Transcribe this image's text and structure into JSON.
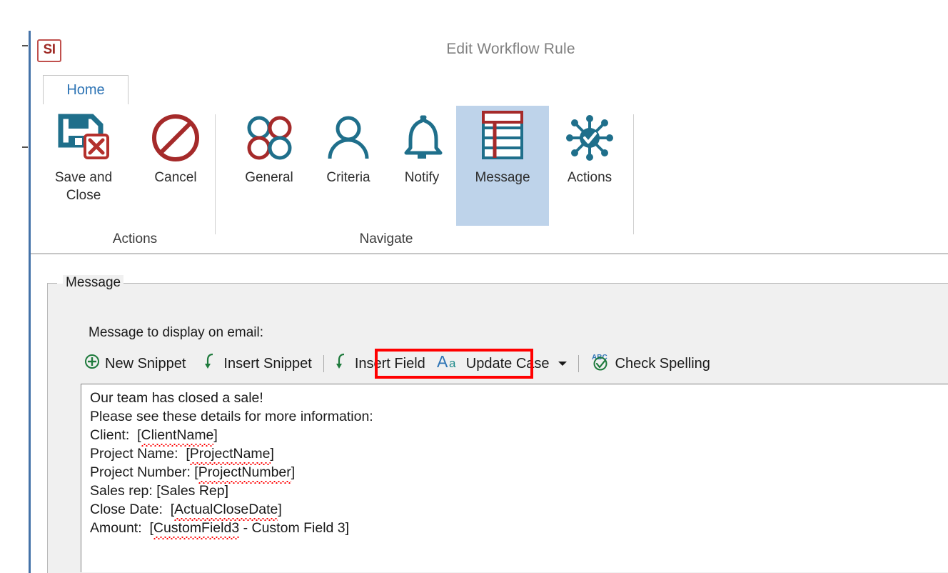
{
  "window": {
    "logo_text": "SI",
    "title": "Edit Workflow Rule"
  },
  "tabs": [
    {
      "label": "Home",
      "selected": true
    }
  ],
  "ribbon": {
    "groups": [
      {
        "name": "actions",
        "label": "Actions",
        "buttons": [
          {
            "name": "save-and-close",
            "label": "Save and\nClose",
            "icon": "save-close-icon"
          },
          {
            "name": "cancel",
            "label": "Cancel",
            "icon": "cancel-icon"
          }
        ]
      },
      {
        "name": "navigate",
        "label": "Navigate",
        "buttons": [
          {
            "name": "general",
            "label": "General",
            "icon": "four-circles-icon",
            "selected": false
          },
          {
            "name": "criteria",
            "label": "Criteria",
            "icon": "person-icon",
            "selected": false
          },
          {
            "name": "notify",
            "label": "Notify",
            "icon": "bell-icon",
            "selected": false
          },
          {
            "name": "message",
            "label": "Message",
            "icon": "table-icon",
            "selected": true
          },
          {
            "name": "actions-nav",
            "label": "Actions",
            "icon": "hub-check-icon",
            "selected": false
          }
        ]
      }
    ]
  },
  "message_panel": {
    "group_title": "Message",
    "field_label": "Message to display on email:",
    "toolbar": [
      {
        "name": "new-snippet",
        "label": "New Snippet",
        "icon": "circle-plus-icon",
        "caret": false
      },
      {
        "name": "insert-snippet",
        "label": "Insert Snippet",
        "icon": "down-arrow-icon",
        "caret": false
      },
      {
        "name": "insert-field",
        "label": "Insert Field",
        "icon": "down-arrow-icon",
        "caret": false
      },
      {
        "name": "update-case",
        "label": "Update Case",
        "icon": "aa-icon",
        "caret": true
      },
      {
        "name": "check-spelling",
        "label": "Check Spelling",
        "icon": "abc-check-icon",
        "caret": false
      }
    ],
    "body_lines": [
      {
        "text": "Our team has closed a sale!",
        "misspelled": []
      },
      {
        "text": "Please see these details for more information:",
        "misspelled": []
      },
      {
        "text": "Client:  [ClientName]",
        "misspelled": [
          "ClientName"
        ]
      },
      {
        "text": "Project Name:  [ProjectName]",
        "misspelled": [
          "ProjectName"
        ]
      },
      {
        "text": "Project Number: [ProjectNumber]",
        "misspelled": [
          "ProjectNumber"
        ]
      },
      {
        "text": "Sales rep: [Sales Rep]",
        "misspelled": []
      },
      {
        "text": "Close Date:  [ActualCloseDate]",
        "misspelled": [
          "ActualCloseDate"
        ]
      },
      {
        "text": "Amount:  [CustomField3 - Custom Field 3]",
        "misspelled": [
          "CustomField3"
        ]
      }
    ]
  },
  "annotation": {
    "highlight_target": "insert-field",
    "color": "#ff0000"
  },
  "colors": {
    "accent_blue": "#1f6f8b",
    "accent_red": "#9e2a25",
    "green": "#1e7a3c",
    "selection": "#bed3ea",
    "panel_bg": "#f0f0f0"
  }
}
